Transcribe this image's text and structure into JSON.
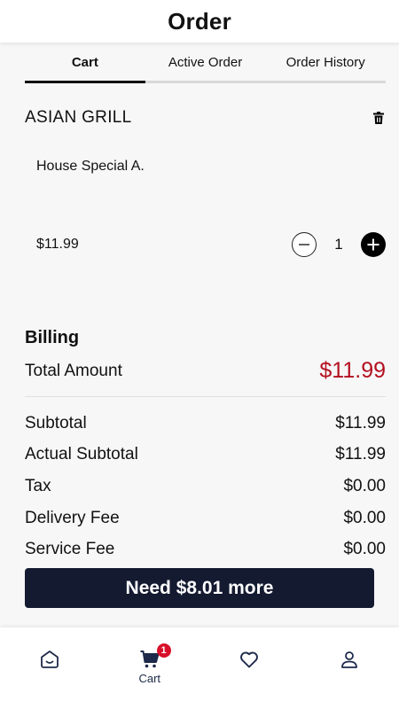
{
  "header": {
    "title": "Order"
  },
  "tabs": [
    {
      "label": "Cart",
      "active": true
    },
    {
      "label": "Active Order",
      "active": false
    },
    {
      "label": "Order History",
      "active": false
    }
  ],
  "cart": {
    "restaurant": "ASIAN GRILL",
    "items": [
      {
        "name": "House Special A.",
        "price": "$11.99",
        "quantity": "1"
      }
    ]
  },
  "billing": {
    "title": "Billing",
    "total_label": "Total Amount",
    "total_value": "$11.99",
    "rows": [
      {
        "label": "Subtotal",
        "value": "$11.99"
      },
      {
        "label": "Actual Subtotal",
        "value": "$11.99"
      },
      {
        "label": "Tax",
        "value": "$0.00"
      },
      {
        "label": "Delivery Fee",
        "value": "$0.00"
      },
      {
        "label": "Service Fee",
        "value": "$0.00"
      }
    ]
  },
  "cta": {
    "label": "Need $8.01 more"
  },
  "bottom_nav": {
    "items": [
      {
        "icon": "home-icon",
        "label": ""
      },
      {
        "icon": "cart-icon",
        "label": "Cart",
        "badge": "1"
      },
      {
        "icon": "heart-icon",
        "label": ""
      },
      {
        "icon": "profile-icon",
        "label": ""
      }
    ]
  },
  "colors": {
    "accent_total": "#b31020",
    "cta_bg": "#141a30",
    "badge": "#d8102a",
    "nav_icon": "#1e2a4a"
  }
}
